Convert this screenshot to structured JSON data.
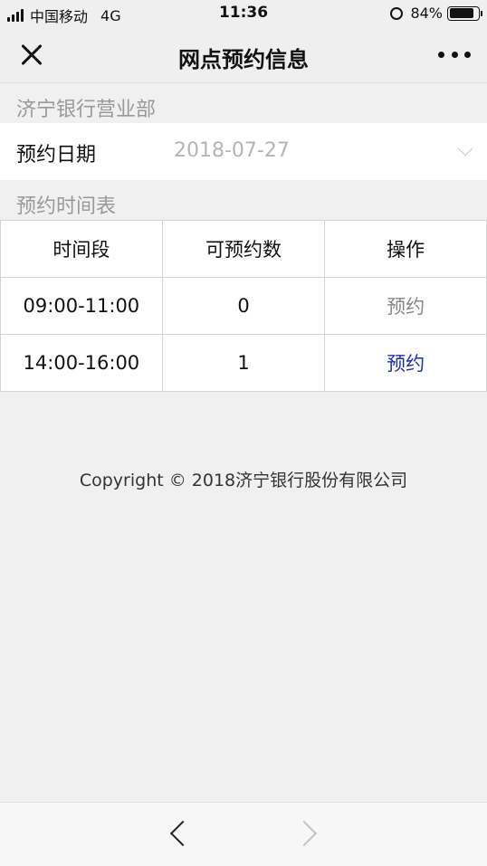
{
  "status_bar": {
    "carrier": "中国移动",
    "network": "4G",
    "time": "11:36",
    "battery": "84%",
    "battery_level": 0.84
  },
  "nav": {
    "title": "网点预约信息",
    "close_icon": "close-icon",
    "more_icon": "more-dots-icon"
  },
  "branch": {
    "name": "济宁银行营业部"
  },
  "date_row": {
    "label": "预约日期",
    "value": "2018-07-27"
  },
  "schedule": {
    "title": "预约时间表",
    "headers": [
      "时间段",
      "可预约数",
      "操作"
    ],
    "rows": [
      {
        "time": "09:00-11:00",
        "available": "0",
        "action": "预约",
        "enabled": false
      },
      {
        "time": "14:00-16:00",
        "available": "1",
        "action": "预约",
        "enabled": true
      }
    ]
  },
  "footer": {
    "copyright": "Copyright © 2018济宁银行股份有限公司"
  },
  "colors": {
    "background": "#f0f0f0",
    "link_active": "#1a2fb8",
    "link_disabled": "#888888",
    "muted_text": "#999999"
  }
}
